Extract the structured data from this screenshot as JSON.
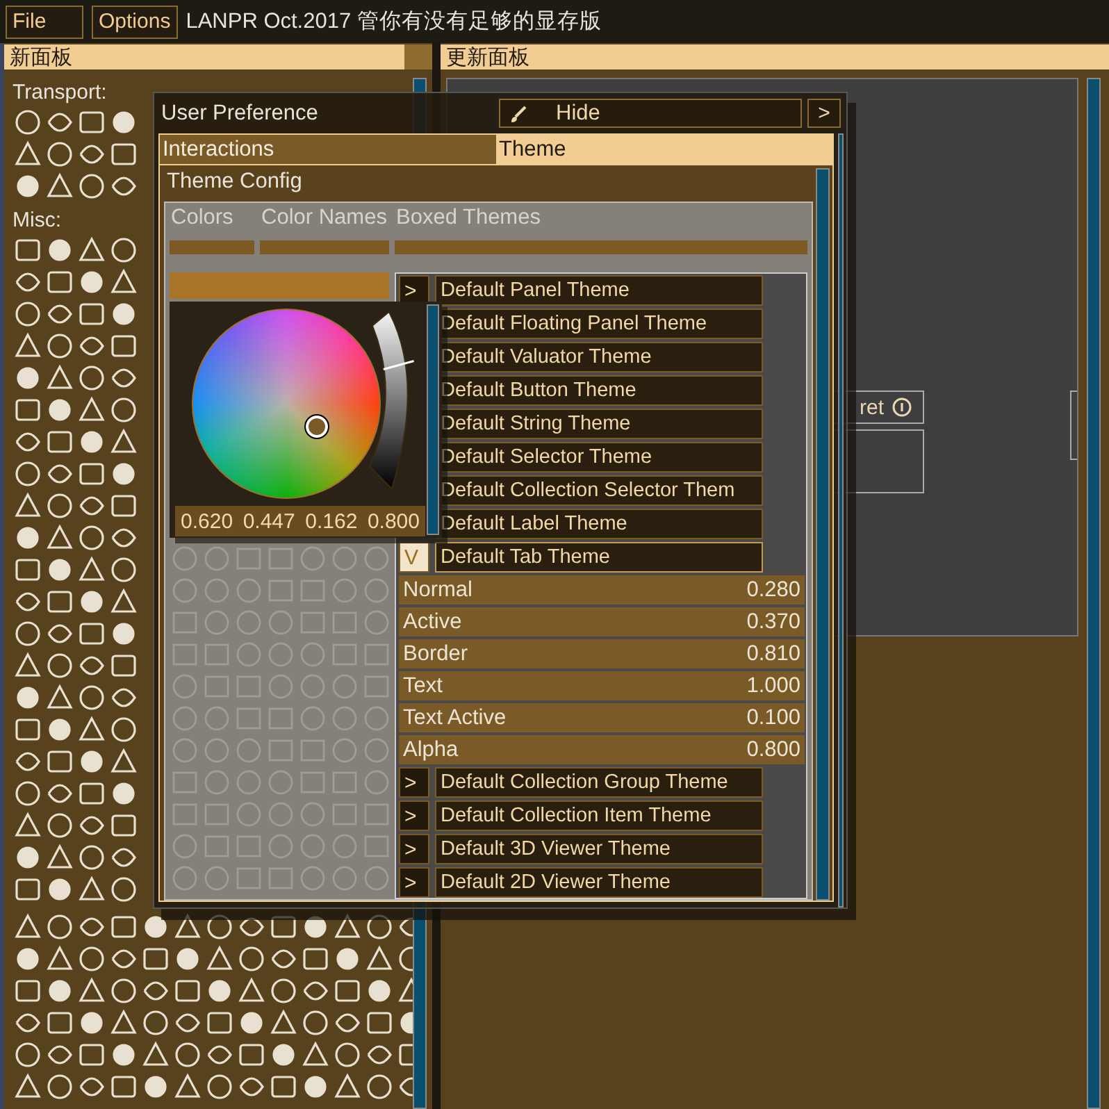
{
  "menu": [
    {
      "label": "File"
    },
    {
      "label": "Options"
    }
  ],
  "app_title": "LANPR Oct.2017 管你有没有足够的显存版",
  "left_panel": {
    "title": "新面板",
    "sections": [
      {
        "label": "Transport:"
      },
      {
        "label": "Misc:"
      }
    ]
  },
  "right_panel": {
    "title": "更新面板",
    "node": {
      "label": "ret"
    }
  },
  "dialog": {
    "title": "User Preference",
    "hide_button": "Hide",
    "more_button": ">",
    "tabs": [
      {
        "label": "Interactions",
        "selected": false
      },
      {
        "label": "Theme",
        "selected": true
      }
    ],
    "section_title": "Theme Config",
    "subtabs": [
      {
        "label": "Colors"
      },
      {
        "label": "Color Names"
      },
      {
        "label": "Boxed Themes"
      }
    ],
    "color_picker": {
      "level": 0.72,
      "values": [
        "0.620",
        "0.447",
        "0.162",
        "0.800"
      ]
    },
    "themes": [
      {
        "expander": ">",
        "label": "Default Panel Theme",
        "expanded": false
      },
      {
        "label": "Default Floating Panel Theme",
        "expanded": false
      },
      {
        "label": "Default Valuator Theme",
        "expanded": false
      },
      {
        "label": "Default Button Theme",
        "expanded": false
      },
      {
        "label": "Default String Theme",
        "expanded": false
      },
      {
        "label": "Default Selector Theme",
        "expanded": false
      },
      {
        "label": "Default Collection Selector Them",
        "expanded": false
      },
      {
        "label": "Default Label Theme",
        "expanded": false
      },
      {
        "expander": "V",
        "label": "Default Tab Theme",
        "expanded": true,
        "properties": [
          {
            "label": "Normal",
            "value": "0.280"
          },
          {
            "label": "Active",
            "value": "0.370"
          },
          {
            "label": "Border",
            "value": "0.810"
          },
          {
            "label": "Text",
            "value": "1.000"
          },
          {
            "label": "Text Active",
            "value": "0.100"
          },
          {
            "label": "Alpha",
            "value": "0.800"
          }
        ]
      },
      {
        "expander": ">",
        "label": "Default Collection Group Theme",
        "expanded": false
      },
      {
        "expander": ">",
        "label": "Default Collection Item Theme",
        "expanded": false
      },
      {
        "expander": ">",
        "label": "Default 3D Viewer Theme",
        "expanded": false
      },
      {
        "expander": ">",
        "label": "Default 2D Viewer Theme",
        "expanded": false
      }
    ]
  }
}
